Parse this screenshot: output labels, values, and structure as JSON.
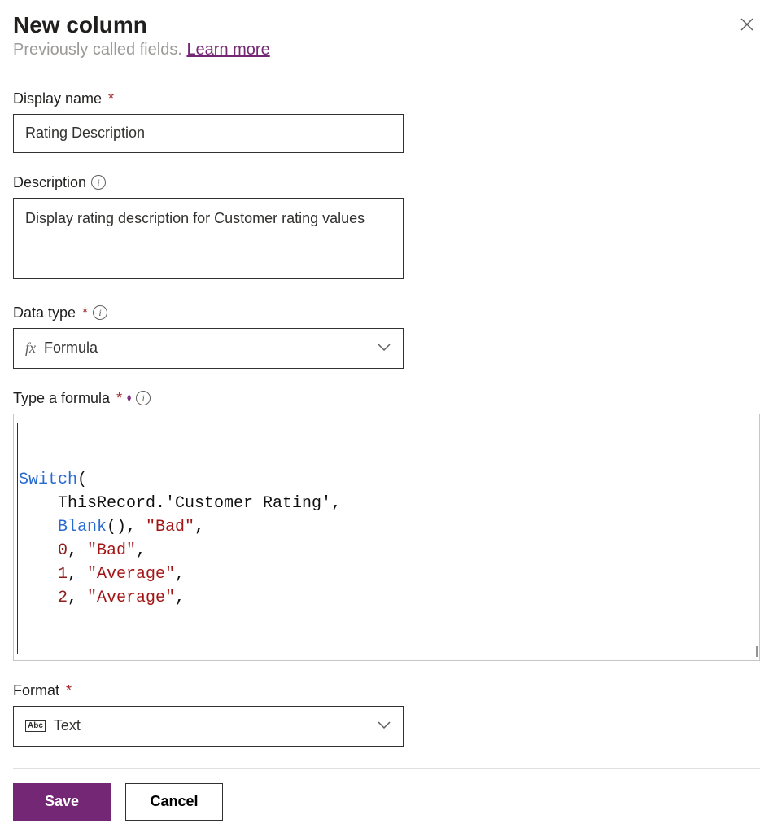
{
  "header": {
    "title": "New column",
    "subtitle_prefix": "Previously called fields. ",
    "learn_more": "Learn more"
  },
  "fields": {
    "display_name": {
      "label": "Display name",
      "required_marker": "*",
      "value": "Rating Description"
    },
    "description": {
      "label": "Description",
      "value": "Display rating description for Customer rating values"
    },
    "data_type": {
      "label": "Data type",
      "required_marker": "*",
      "icon_text": "fx",
      "value": "Formula"
    },
    "formula": {
      "label": "Type a formula",
      "required_marker": "*",
      "tokens": {
        "switch": "Switch",
        "openp": "(",
        "line2": "    ThisRecord.'Customer Rating',",
        "blank": "Blank",
        "blankp": "(), ",
        "bad": "\"Bad\"",
        "comma": ",",
        "n0": "0",
        "cs": ", ",
        "n1": "1",
        "avg": "\"Average\"",
        "n2": "2"
      }
    },
    "format": {
      "label": "Format",
      "required_marker": "*",
      "icon_text": "Abc",
      "value": "Text"
    }
  },
  "buttons": {
    "save": "Save",
    "cancel": "Cancel"
  }
}
